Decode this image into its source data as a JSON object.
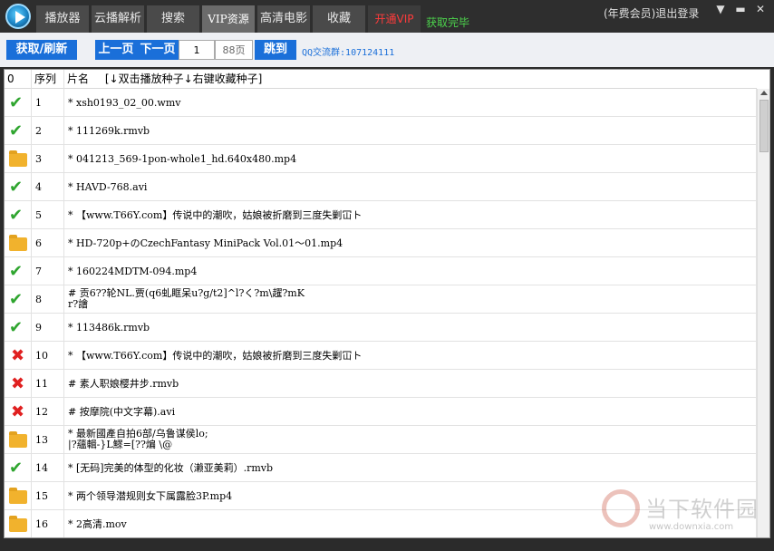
{
  "tabs": [
    {
      "label": "播放器"
    },
    {
      "label": "云播解析"
    },
    {
      "label": "搜索"
    },
    {
      "label": "VIP资源"
    },
    {
      "label": "高清电影"
    },
    {
      "label": "收藏"
    },
    {
      "label": "开通VIP"
    }
  ],
  "status": "获取完毕",
  "account": "(年费会员)退出登录",
  "window_buttons": [
    "▼",
    "▬",
    "✕"
  ],
  "toolbar": {
    "fetch_label": "获取/刷新",
    "prev_label": "上一页",
    "next_label": "下一页",
    "page_value": "1",
    "total_pages": "88页",
    "jump_label": "跳到",
    "qq_group": "QQ交流群:107124111"
  },
  "table": {
    "columns": [
      "0",
      "序列",
      "片名",
      "[↓双击播放种子↓右键收藏种子]"
    ],
    "rows": [
      {
        "status": "check-icon",
        "seq": "1",
        "name": "* xsh0193_02_00.wmv"
      },
      {
        "status": "check-icon",
        "seq": "2",
        "name": "* 111269k.rmvb"
      },
      {
        "status": "folder-icon",
        "seq": "3",
        "name": "* 041213_569-1pon-whole1_hd.640x480.mp4"
      },
      {
        "status": "check-icon",
        "seq": "4",
        "name": "* HAVD-768.avi"
      },
      {
        "status": "check-icon",
        "seq": "5",
        "name": "* 【www.T66Y.com】传说中的潮吹，姑娘被折磨到三度失剿冚ト"
      },
      {
        "status": "folder-icon",
        "seq": "6",
        "name": "* HD-720p+のCzechFantasy MiniPack Vol.01～01.mp4"
      },
      {
        "status": "check-icon",
        "seq": "7",
        "name": "* 160224MDTM-094.mp4"
      },
      {
        "status": "check-icon",
        "seq": "8",
        "name": "# 贡6??轮NL.贾(q6虬眶呆u?g/t2]^l?く?m\\趯?mK",
        "name2": "r?譮"
      },
      {
        "status": "check-icon",
        "seq": "9",
        "name": "* 113486k.rmvb"
      },
      {
        "status": "cross-icon",
        "seq": "10",
        "name": "* 【www.T66Y.com】传说中的潮吹，姑娘被折磨到三度失剿冚ト"
      },
      {
        "status": "cross-icon",
        "seq": "11",
        "name": "# 素人职娘樱井步.rmvb"
      },
      {
        "status": "cross-icon",
        "seq": "12",
        "name": "# 按摩院(中文字幕).avi"
      },
      {
        "status": "folder-icon",
        "seq": "13",
        "name": "* 最新國產自拍6部/乌鲁谋侯lo;",
        "name2": "|?蘊輯-}L鰥=[??煸 \\@"
      },
      {
        "status": "check-icon",
        "seq": "14",
        "name": "* [无码]完美的体型的化妆（濑亚美莉）.rmvb"
      },
      {
        "status": "folder-icon",
        "seq": "15",
        "name": "* 两个领导潜规则女下属露脸3P.mp4"
      },
      {
        "status": "folder-icon",
        "seq": "16",
        "name": "* 2高清.mov"
      }
    ]
  },
  "watermark": {
    "text": "当下软件园",
    "url": "www.downxia.com"
  }
}
